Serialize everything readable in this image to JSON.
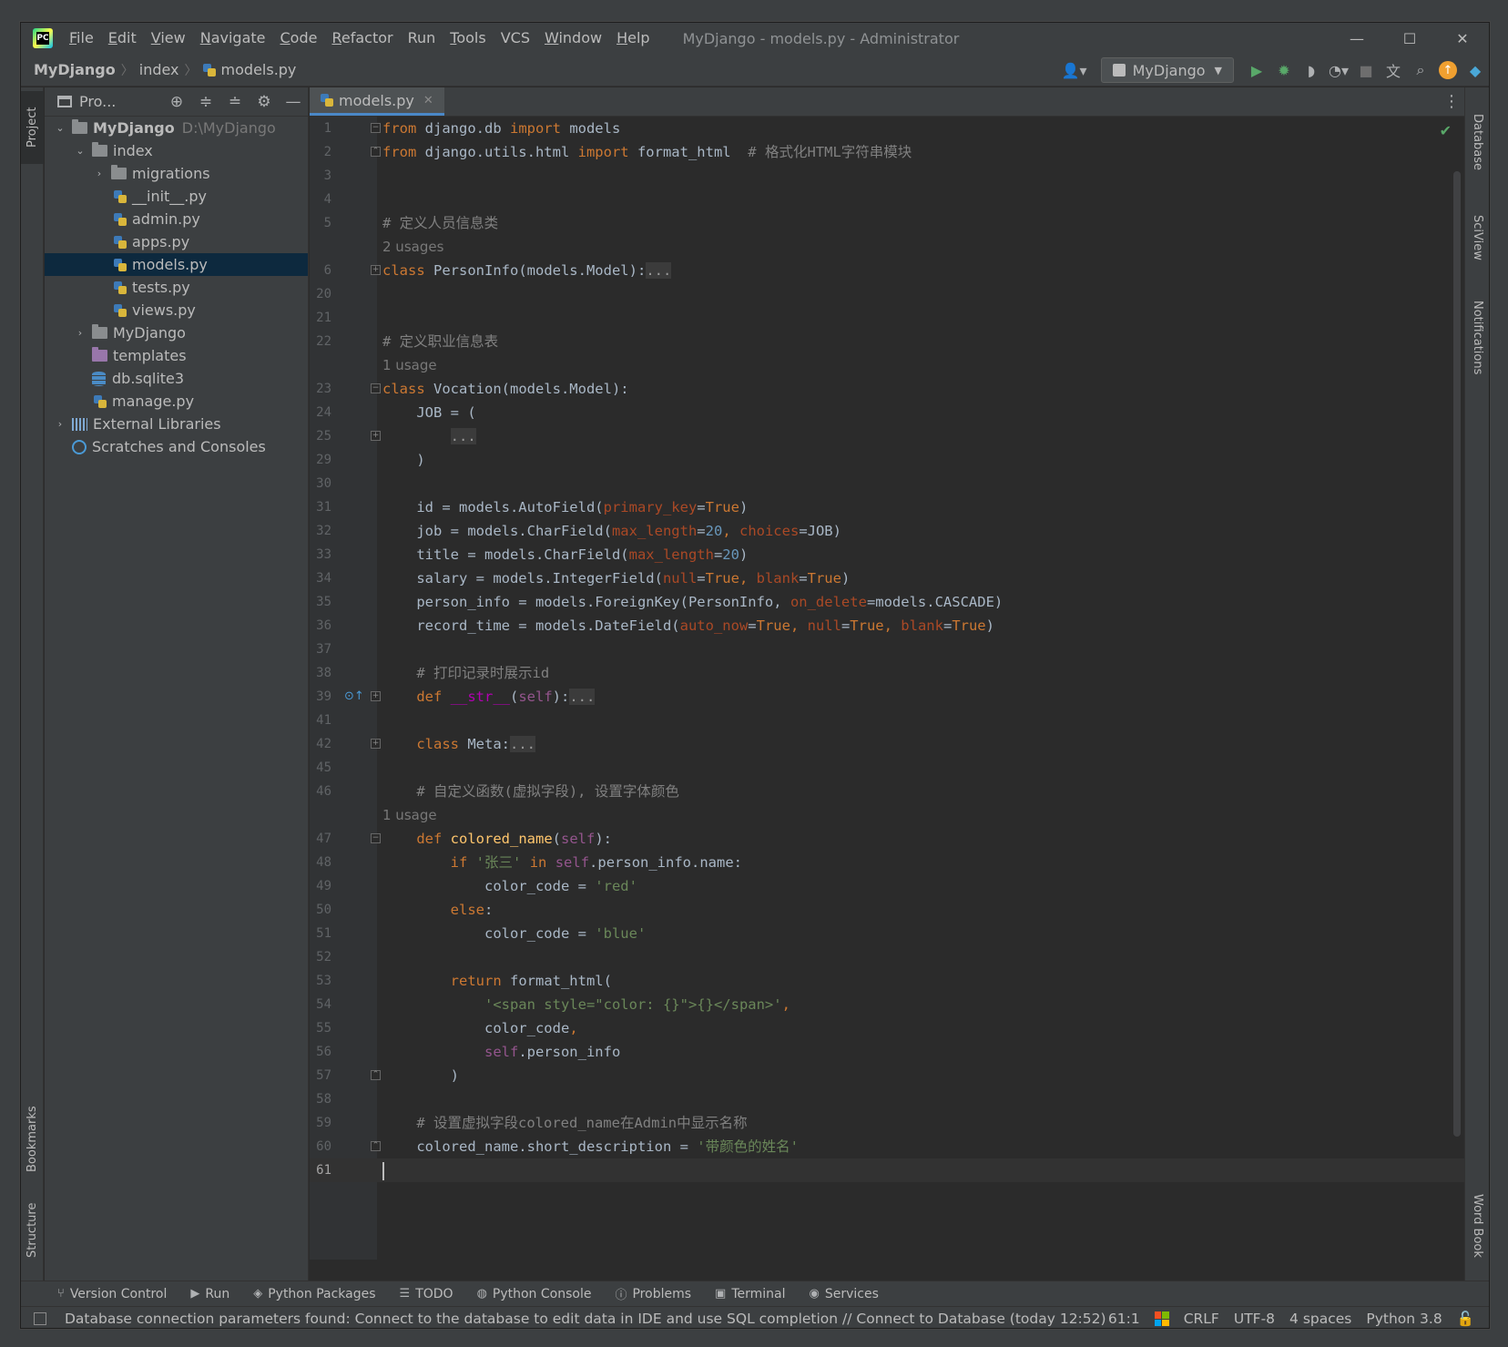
{
  "window": {
    "title": "MyDjango - models.py - Administrator",
    "menu": [
      "File",
      "Edit",
      "View",
      "Navigate",
      "Code",
      "Refactor",
      "Run",
      "Tools",
      "VCS",
      "Window",
      "Help"
    ],
    "controls": {
      "minimize": "—",
      "maximize": "☐",
      "close": "✕"
    },
    "logo_text": "PC"
  },
  "navbar": {
    "breadcrumbs": [
      "MyDjango",
      "index",
      "models.py"
    ],
    "run_config": "MyDjango"
  },
  "left_strip": {
    "top": "Project",
    "bottom": [
      "Bookmarks",
      "Structure"
    ]
  },
  "right_strip": [
    "Database",
    "SciView",
    "Notifications",
    "Word Book"
  ],
  "project_panel": {
    "title": "Pro...",
    "tree": [
      {
        "label": "MyDjango",
        "path": "D:\\MyDjango"
      },
      {
        "label": "index"
      },
      {
        "label": "migrations"
      },
      {
        "label": "__init__.py"
      },
      {
        "label": "admin.py"
      },
      {
        "label": "apps.py"
      },
      {
        "label": "models.py"
      },
      {
        "label": "tests.py"
      },
      {
        "label": "views.py"
      },
      {
        "label": "MyDjango"
      },
      {
        "label": "templates"
      },
      {
        "label": "db.sqlite3"
      },
      {
        "label": "manage.py"
      },
      {
        "label": "External Libraries"
      },
      {
        "label": "Scratches and Consoles"
      }
    ]
  },
  "editor": {
    "tab": "models.py",
    "line_numbers": [
      "1",
      "2",
      "3",
      "4",
      "5",
      "",
      "6",
      "20",
      "21",
      "22",
      "",
      "23",
      "24",
      "25",
      "29",
      "30",
      "31",
      "32",
      "33",
      "34",
      "35",
      "36",
      "37",
      "38",
      "39",
      "41",
      "42",
      "45",
      "46",
      "",
      "47",
      "48",
      "49",
      "50",
      "51",
      "52",
      "53",
      "54",
      "55",
      "56",
      "57",
      "58",
      "59",
      "60",
      "61"
    ],
    "hints": {
      "h1": "2 usages",
      "h2": "1 usage",
      "h3": "1 usage"
    },
    "code": {
      "l1": [
        "from",
        " django.db ",
        "import",
        " models"
      ],
      "l2": [
        "from",
        " django.utils.html ",
        "import",
        " format_html  ",
        "# 格式化HTML字符串模块"
      ],
      "l5": "# 定义人员信息类",
      "l6": [
        "class",
        " PersonInfo(models.Model):",
        "..."
      ],
      "l22": "# 定义职业信息表",
      "l23": [
        "class",
        " Vocation(models.Model):"
      ],
      "l24": "    JOB = (",
      "l25": [
        "        ",
        "..."
      ],
      "l29": "    )",
      "l31": [
        "    id = models.AutoField(",
        "primary_key",
        "=",
        "True",
        ")"
      ],
      "l32": [
        "    job = models.CharField(",
        "max_length",
        "=",
        "20",
        ", ",
        "choices",
        "=JOB)"
      ],
      "l33": [
        "    title = models.CharField(",
        "max_length",
        "=",
        "20",
        ")"
      ],
      "l34": [
        "    salary = models.IntegerField(",
        "null",
        "=",
        "True",
        ", ",
        "blank",
        "=",
        "True",
        ")"
      ],
      "l35": [
        "    person_info = models.ForeignKey(PersonInfo, ",
        "on_delete",
        "=models.CASCADE)"
      ],
      "l36": [
        "    record_time = models.DateField(",
        "auto_now",
        "=",
        "True",
        ", ",
        "null",
        "=",
        "True",
        ", ",
        "blank",
        "=",
        "True",
        ")"
      ],
      "l38": "    # 打印记录时展示id",
      "l39": [
        "    ",
        "def",
        " ",
        "__str__",
        "(",
        "self",
        "):",
        "..."
      ],
      "l42": [
        "    ",
        "class",
        " Meta:",
        "..."
      ],
      "l46": "    # 自定义函数(虚拟字段), 设置字体颜色",
      "l47": [
        "    ",
        "def",
        " ",
        "colored_name",
        "(",
        "self",
        "):"
      ],
      "l48": [
        "        ",
        "if",
        " ",
        "'张三'",
        " ",
        "in",
        " ",
        "self",
        ".person_info.name:"
      ],
      "l49": [
        "            color_code = ",
        "'red'"
      ],
      "l50": [
        "        ",
        "else",
        ":"
      ],
      "l51": [
        "            color_code = ",
        "'blue'"
      ],
      "l53": [
        "        ",
        "return",
        " format_html("
      ],
      "l54": [
        "            ",
        "'<span style=\"color: {}\">{}</span>'",
        ","
      ],
      "l55": [
        "            color_code",
        ","
      ],
      "l56": [
        "            ",
        "self",
        ".person_info"
      ],
      "l57": "        )",
      "l59": "    # 设置虚拟字段colored_name在Admin中显示名称",
      "l60": [
        "    colored_name.short_description = ",
        "'带颜色的姓名'"
      ]
    }
  },
  "bottom_tools": [
    "Version Control",
    "Run",
    "Python Packages",
    "TODO",
    "Python Console",
    "Problems",
    "Terminal",
    "Services"
  ],
  "status": {
    "message": "Database connection parameters found: Connect to the database to edit data in IDE and use SQL completion // Connect to Database (today 12:52)",
    "position": "61:1",
    "line_sep": "CRLF",
    "encoding": "UTF-8",
    "indent": "4 spaces",
    "interpreter": "Python 3.8"
  },
  "colors": {
    "keyword": "#cc7832",
    "string": "#6a8759",
    "number": "#6897bb",
    "comment": "#808080",
    "self": "#94558d",
    "param": "#aa4926",
    "function": "#ffc66d",
    "selection": "#0d293e"
  }
}
